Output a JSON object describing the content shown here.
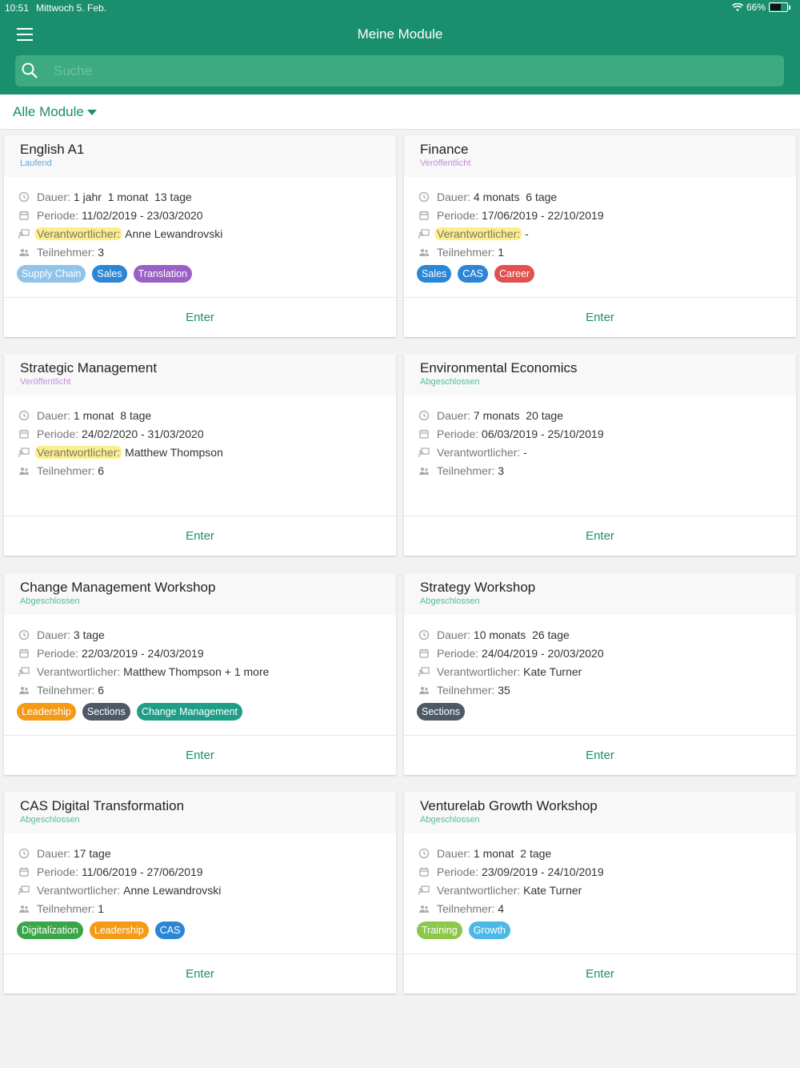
{
  "status_bar": {
    "time": "10:51",
    "date": "Mittwoch 5. Feb.",
    "battery": "66%"
  },
  "header": {
    "title": "Meine Module"
  },
  "search": {
    "placeholder": "Suche"
  },
  "filter": {
    "label": "Alle Module"
  },
  "labels": {
    "dauer": "Dauer:",
    "periode": "Periode:",
    "verantwortlicher": "Verantwortlicher:",
    "teilnehmer": "Teilnehmer:",
    "enter": "Enter"
  },
  "colors": {
    "primary": "#1a8f6e",
    "status_laufend": "#5aa9e6",
    "status_veroeffentlicht": "#c58de0",
    "status_abgeschlossen": "#4fc08d"
  },
  "modules": [
    {
      "title": "English A1",
      "status": "Laufend",
      "status_color": "#5aa9e6",
      "dauer": "1 jahr  1 monat  13 tage",
      "periode": "11/02/2019 - 23/03/2020",
      "verantwortlicher": "Anne Lewandrovski",
      "teilnehmer": "3",
      "highlight": true,
      "tags": [
        {
          "label": "Supply Chain",
          "color": "#90c3ea"
        },
        {
          "label": "Sales",
          "color": "#2b86d6"
        },
        {
          "label": "Translation",
          "color": "#9a60c6"
        }
      ]
    },
    {
      "title": "Finance",
      "status": "Veröffentlicht",
      "status_color": "#c58de0",
      "dauer": "4 monats  6 tage",
      "periode": "17/06/2019 - 22/10/2019",
      "verantwortlicher": "-",
      "teilnehmer": "1",
      "highlight": true,
      "tags": [
        {
          "label": "Sales",
          "color": "#2b86d6"
        },
        {
          "label": "CAS",
          "color": "#2b86d6"
        },
        {
          "label": "Career",
          "color": "#e0524f"
        }
      ]
    },
    {
      "title": "Strategic Management",
      "status": "Veröffentlicht",
      "status_color": "#c58de0",
      "dauer": "1 monat  8 tage",
      "periode": "24/02/2020 - 31/03/2020",
      "verantwortlicher": "Matthew Thompson",
      "teilnehmer": "6",
      "highlight": true,
      "tags": []
    },
    {
      "title": "Environmental Economics",
      "status": "Abgeschlossen",
      "status_color": "#4fc08d",
      "dauer": "7 monats  20 tage",
      "periode": "06/03/2019 - 25/10/2019",
      "verantwortlicher": "-",
      "teilnehmer": "3",
      "highlight": false,
      "tags": []
    },
    {
      "title": "Change Management Workshop",
      "status": "Abgeschlossen",
      "status_color": "#4fc08d",
      "dauer": "3 tage",
      "periode": "22/03/2019 - 24/03/2019",
      "verantwortlicher": "Matthew Thompson + 1 more",
      "teilnehmer": "6",
      "highlight": false,
      "tags": [
        {
          "label": "Leadership",
          "color": "#f59a14"
        },
        {
          "label": "Sections",
          "color": "#4d5a66"
        },
        {
          "label": "Change Management",
          "color": "#1f9e87"
        }
      ]
    },
    {
      "title": "Strategy Workshop",
      "status": "Abgeschlossen",
      "status_color": "#4fc08d",
      "dauer": "10 monats  26 tage",
      "periode": "24/04/2019 - 20/03/2020",
      "verantwortlicher": "Kate Turner",
      "teilnehmer": "35",
      "highlight": false,
      "tags": [
        {
          "label": "Sections",
          "color": "#4d5a66"
        }
      ]
    },
    {
      "title": "CAS Digital Transformation",
      "status": "Abgeschlossen",
      "status_color": "#4fc08d",
      "dauer": "17 tage",
      "periode": "11/06/2019 - 27/06/2019",
      "verantwortlicher": "Anne Lewandrovski",
      "teilnehmer": "1",
      "highlight": false,
      "tags": [
        {
          "label": "Digitalization",
          "color": "#3aa64a"
        },
        {
          "label": "Leadership",
          "color": "#f59a14"
        },
        {
          "label": "CAS",
          "color": "#2b86d6"
        }
      ]
    },
    {
      "title": "Venturelab Growth Workshop",
      "status": "Abgeschlossen",
      "status_color": "#4fc08d",
      "dauer": "1 monat  2 tage",
      "periode": "23/09/2019 - 24/10/2019",
      "verantwortlicher": "Kate Turner",
      "teilnehmer": "4",
      "highlight": false,
      "tags": [
        {
          "label": "Training",
          "color": "#8cc84b"
        },
        {
          "label": "Growth",
          "color": "#4cb8e8"
        }
      ]
    }
  ]
}
